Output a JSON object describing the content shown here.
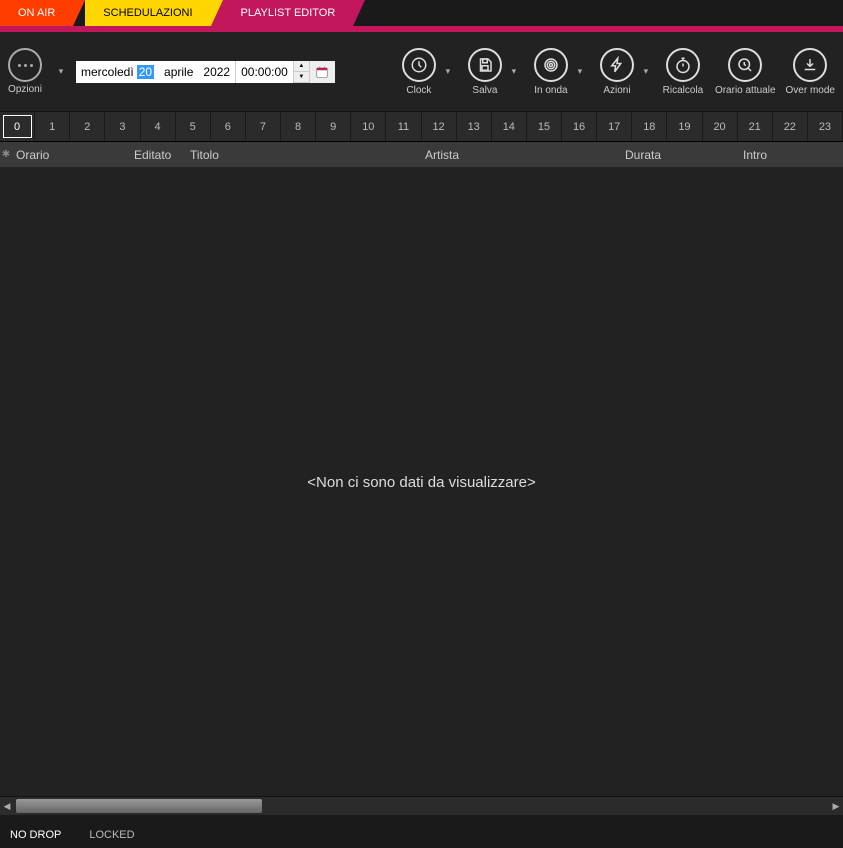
{
  "tabs": {
    "onair": "ON AIR",
    "schedule": "SCHEDULAZIONI",
    "playlist": "PLAYLIST EDITOR"
  },
  "options": {
    "label": "Opzioni"
  },
  "date": {
    "weekday": "mercoledì",
    "day": "20",
    "month": "aprile",
    "year": "2022",
    "time": "00:00:00"
  },
  "tools": {
    "clock": "Clock",
    "salva": "Salva",
    "inonda": "In onda",
    "azioni": "Azioni",
    "ricalcola": "Ricalcola",
    "orario": "Orario attuale",
    "over": "Over mode"
  },
  "hours": [
    "0",
    "1",
    "2",
    "3",
    "4",
    "5",
    "6",
    "7",
    "8",
    "9",
    "10",
    "11",
    "12",
    "13",
    "14",
    "15",
    "16",
    "17",
    "18",
    "19",
    "20",
    "21",
    "22",
    "23"
  ],
  "selected_hour": 0,
  "columns": {
    "orario": "Orario",
    "editato": "Editato",
    "titolo": "Titolo",
    "artista": "Artista",
    "durata": "Durata",
    "intro": "Intro"
  },
  "empty_message": "<Non ci sono dati da visualizzare>",
  "status": {
    "nodrop": "NO DROP",
    "locked": "LOCKED"
  }
}
